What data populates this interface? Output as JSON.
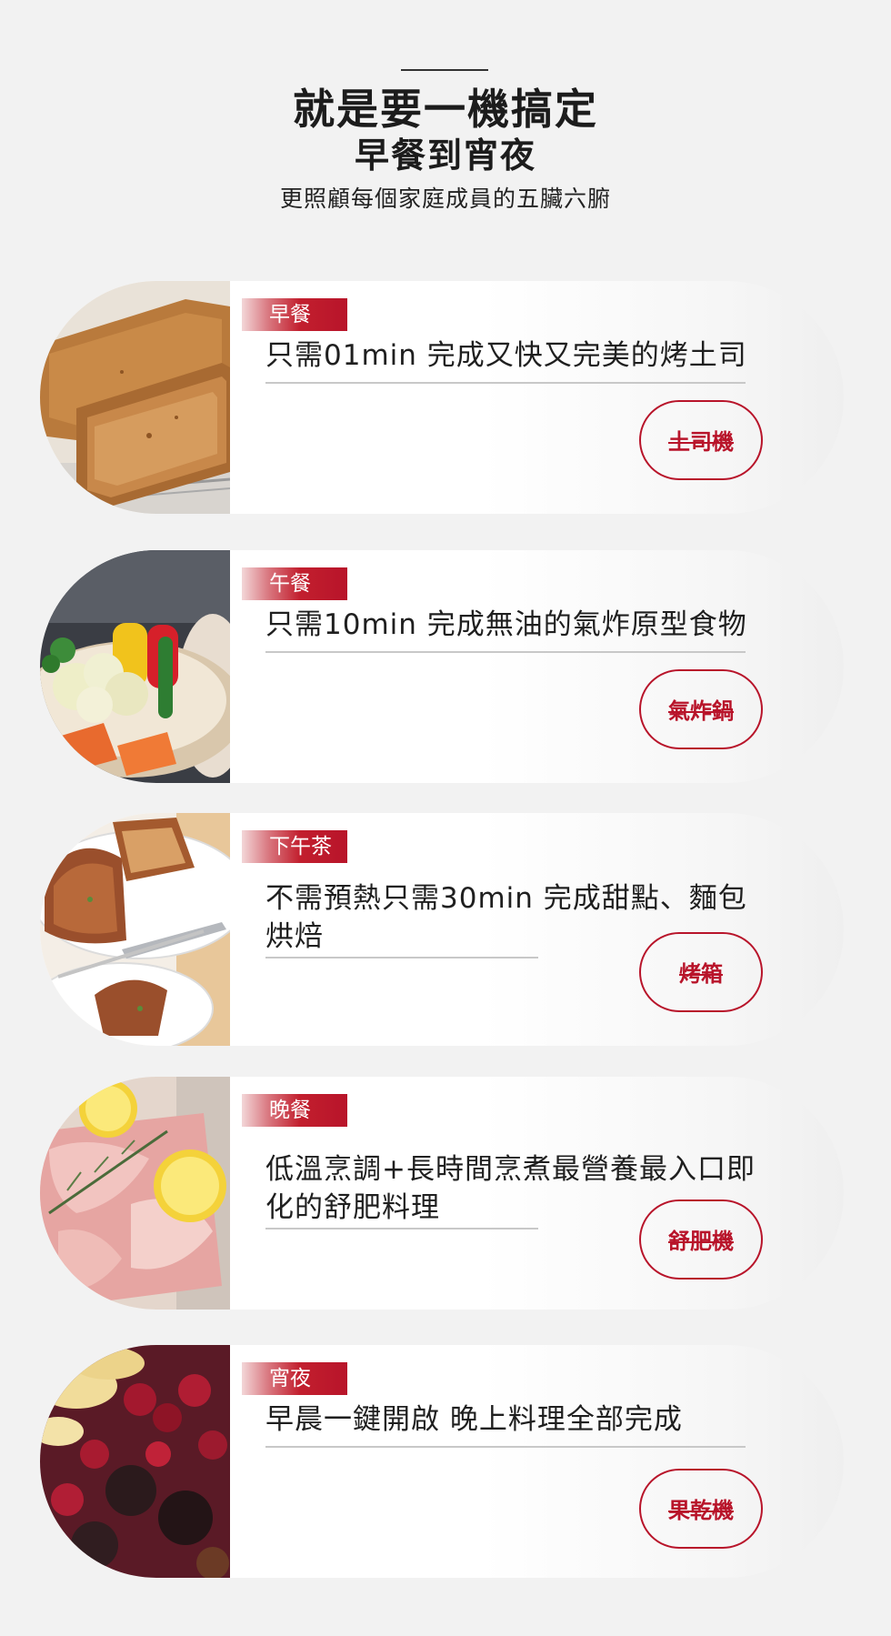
{
  "header": {
    "title": "就是要一機搞定",
    "subtitle": "早餐到宵夜",
    "description": "更照顧每個家庭成員的五臟六腑"
  },
  "meals": [
    {
      "tag": "早餐",
      "text": "只需01min 完成又快又完美的烤土司",
      "appliance": "土司機",
      "photo": "toast-photo"
    },
    {
      "tag": "午餐",
      "text": "只需10min 完成無油的氣炸原型食物",
      "appliance": "氣炸鍋",
      "photo": "vegetables-photo"
    },
    {
      "tag": "下午茶",
      "text": "不需預熱只需30min 完成甜點、麵包烘焙",
      "appliance": "烤箱",
      "photo": "cake-photo"
    },
    {
      "tag": "晚餐",
      "text": "低溫烹調+長時間烹煮最營養最入口即化的舒肥料理",
      "appliance": "舒肥機",
      "photo": "sous-vide-meat-photo"
    },
    {
      "tag": "宵夜",
      "text": "早晨一鍵開啟 晚上料理全部完成",
      "appliance": "果乾機",
      "photo": "dried-fruit-photo"
    }
  ],
  "colors": {
    "accent": "#b8142a",
    "background": "#f2f2f2",
    "text": "#1f1f1f"
  }
}
